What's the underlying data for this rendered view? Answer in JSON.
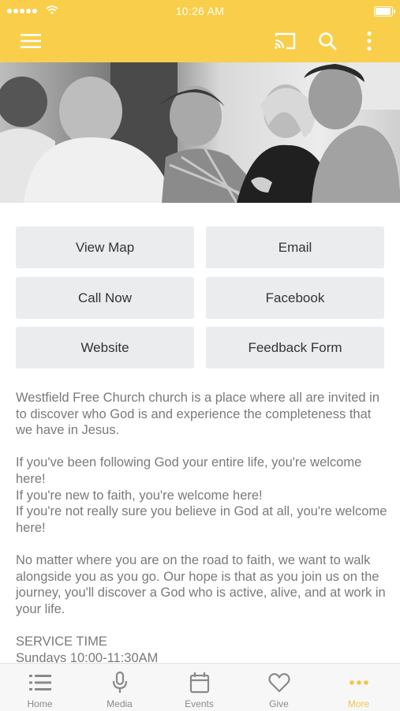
{
  "status_bar": {
    "time": "10:26 AM"
  },
  "header": {
    "icons": [
      "menu-icon",
      "cast-icon",
      "search-icon",
      "more-vert-icon"
    ]
  },
  "actions": {
    "view_map": "View Map",
    "email": "Email",
    "call_now": "Call Now",
    "facebook": "Facebook",
    "website": "Website",
    "feedback_form": "Feedback Form"
  },
  "content": {
    "p1": "Westfield Free Church church is a place where all are invited in to discover who God is and experience the completeness that we have in Jesus.",
    "p2_line1": "If you've been following God your entire life, you're welcome here!",
    "p2_line2": "If you're new to faith, you're welcome here!",
    "p2_line3": "If you're not really sure you believe in God at all, you're welcome here!",
    "p3": "No matter where you are on the road to faith, we want to walk alongside you as you go. Our hope is that as you join us on the journey, you'll discover a God who is active, alive, and at work in your life.",
    "service_heading": "SERVICE TIME",
    "service_time": "Sundays 10:00-11:30AM"
  },
  "tabs": [
    {
      "label": "Home",
      "icon": "list-icon"
    },
    {
      "label": "Media",
      "icon": "microphone-icon"
    },
    {
      "label": "Events",
      "icon": "calendar-icon"
    },
    {
      "label": "Give",
      "icon": "heart-icon"
    },
    {
      "label": "More",
      "icon": "more-horiz-icon",
      "active": true
    }
  ],
  "colors": {
    "brand": "#F9CE4A",
    "active_tab": "#F5C542",
    "button_bg": "#EBECEE"
  }
}
